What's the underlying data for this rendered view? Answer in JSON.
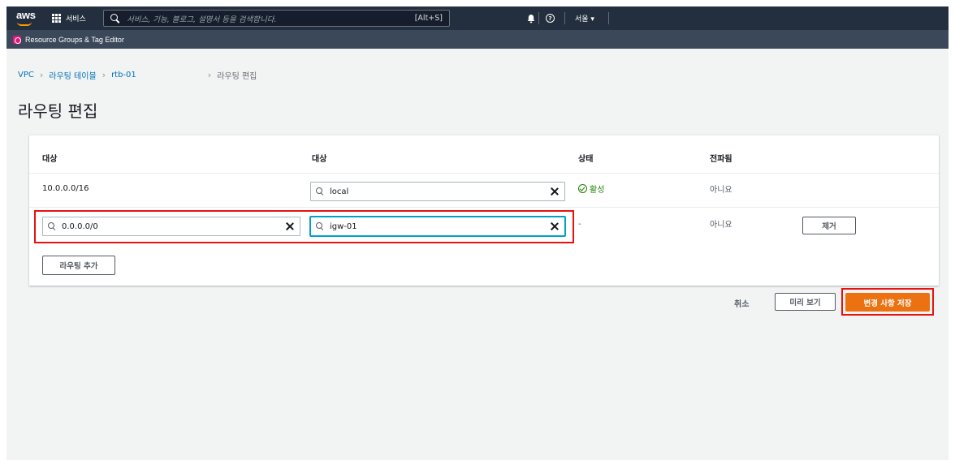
{
  "topnav": {
    "logo": "aws",
    "services_label": "서비스",
    "search_placeholder": "서비스, 기능, 블로그, 설명서 등을 검색합니다.",
    "search_shortcut": "[Alt+S]",
    "region": "서울 ▾"
  },
  "subnav": {
    "label": "Resource Groups & Tag Editor"
  },
  "breadcrumb": {
    "items": [
      "VPC",
      "라우팅 테이블",
      "rtb-01",
      "라우팅 편집"
    ],
    "separator": "›"
  },
  "page_title": "라우팅 편집",
  "table": {
    "headers": [
      "대상",
      "대상",
      "상태",
      "전파됨"
    ],
    "rows": [
      {
        "destination": "10.0.0.0/16",
        "target": "local",
        "status": "활성",
        "propagated": "아니요"
      },
      {
        "destination": "0.0.0.0/0",
        "target": "igw-01",
        "status": "-",
        "propagated": "아니요",
        "remove": "제거"
      }
    ],
    "add_route": "라우팅 추가"
  },
  "footer": {
    "cancel": "취소",
    "preview": "미리 보기",
    "save": "변경 사항 저장"
  },
  "colors": {
    "nav": "#232f3e",
    "accent": "#ec7211",
    "highlight": "#e8110f",
    "active": "#1d8102"
  }
}
